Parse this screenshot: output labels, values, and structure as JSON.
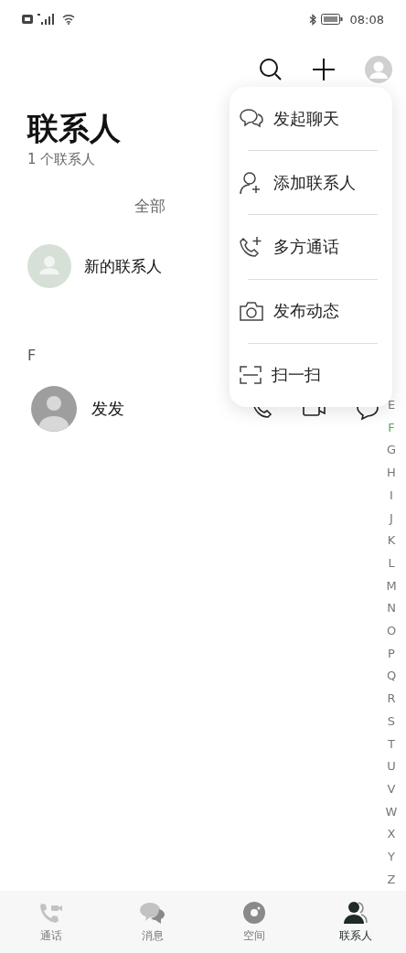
{
  "status_bar": {
    "time": "08:08"
  },
  "header": {
    "title": "联系人",
    "subtitle": "1 个联系人"
  },
  "filter": {
    "label": "全部"
  },
  "new_contact": {
    "label": "新的联系人"
  },
  "sections": [
    {
      "letter": "F",
      "contacts": [
        {
          "name": "发发"
        }
      ]
    }
  ],
  "menu": [
    {
      "kind": "chat",
      "label": "发起聊天"
    },
    {
      "kind": "add",
      "label": "添加联系人"
    },
    {
      "kind": "call",
      "label": "多方通话"
    },
    {
      "kind": "camera",
      "label": "发布动态"
    },
    {
      "kind": "scan",
      "label": "扫一扫"
    }
  ],
  "index": [
    {
      "letter": "E",
      "selected": false
    },
    {
      "letter": "F",
      "selected": true
    },
    {
      "letter": "G",
      "selected": false
    },
    {
      "letter": "H",
      "selected": false
    },
    {
      "letter": "I",
      "selected": false
    },
    {
      "letter": "J",
      "selected": false
    },
    {
      "letter": "K",
      "selected": false
    },
    {
      "letter": "L",
      "selected": false
    },
    {
      "letter": "M",
      "selected": false
    },
    {
      "letter": "N",
      "selected": false
    },
    {
      "letter": "O",
      "selected": false
    },
    {
      "letter": "P",
      "selected": false
    },
    {
      "letter": "Q",
      "selected": false
    },
    {
      "letter": "R",
      "selected": false
    },
    {
      "letter": "S",
      "selected": false
    },
    {
      "letter": "T",
      "selected": false
    },
    {
      "letter": "U",
      "selected": false
    },
    {
      "letter": "V",
      "selected": false
    },
    {
      "letter": "W",
      "selected": false
    },
    {
      "letter": "X",
      "selected": false
    },
    {
      "letter": "Y",
      "selected": false
    },
    {
      "letter": "Z",
      "selected": false
    }
  ],
  "tabs": [
    {
      "kind": "calls",
      "label": "通话",
      "selected": false
    },
    {
      "kind": "messages",
      "label": "消息",
      "selected": false
    },
    {
      "kind": "space",
      "label": "空间",
      "selected": false
    },
    {
      "kind": "contacts",
      "label": "联系人",
      "selected": true
    }
  ]
}
